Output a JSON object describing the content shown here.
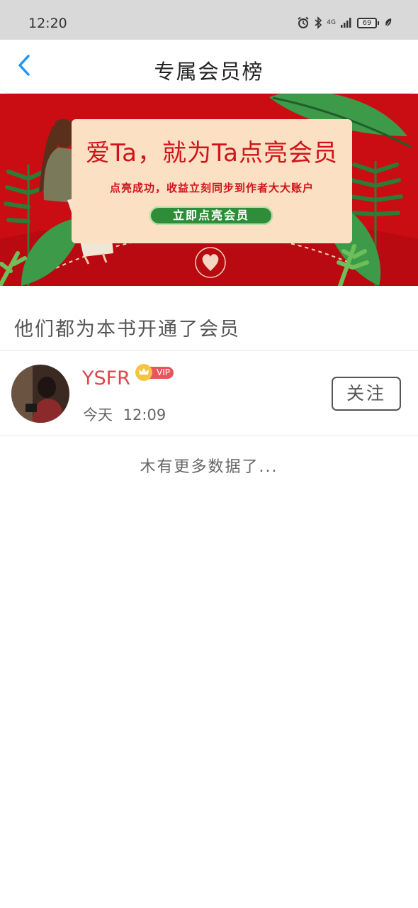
{
  "status_bar": {
    "time": "12:20",
    "network": "4G",
    "battery": "69"
  },
  "header": {
    "title": "专属会员榜",
    "back_icon": "chevron-left-icon",
    "accent_color": "#2196f3"
  },
  "banner": {
    "title": "爱Ta，就为Ta点亮会员",
    "subtitle": "点亮成功，收益立刻同步到作者大大账户",
    "cta_label": "立即点亮会员",
    "background_color": "#c90d12"
  },
  "section": {
    "heading": "他们都为本书开通了会员"
  },
  "members": [
    {
      "name": "YSFR",
      "badge": "VIP",
      "time": "今天 12:09",
      "follow_label": "关注"
    }
  ],
  "footer": {
    "no_more_text": "木有更多数据了..."
  }
}
